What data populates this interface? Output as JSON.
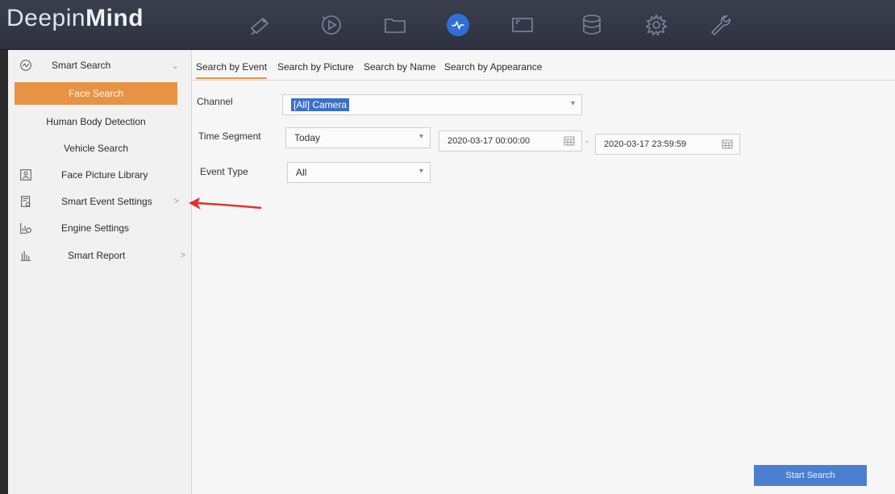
{
  "app": {
    "logo_light": "Deepin",
    "logo_bold": "Mind"
  },
  "topbar": {
    "icons": [
      "camera-icon",
      "playback-icon",
      "folder-icon",
      "smart-analysis-icon",
      "video-wall-icon",
      "storage-icon",
      "settings-gear-icon",
      "maintenance-wrench-icon"
    ],
    "active_icon": "smart-analysis-icon"
  },
  "sidebar": {
    "items": [
      {
        "label": "Smart Search",
        "icon": "smart-search-icon",
        "chevron": "⌄"
      },
      {
        "label": "Face Search",
        "active": true
      },
      {
        "label": "Human Body Detection"
      },
      {
        "label": "Vehicle Search"
      },
      {
        "label": "Face Picture Library",
        "icon": "face-library-icon"
      },
      {
        "label": "Smart Event Settings",
        "icon": "event-settings-icon",
        "chevron": ">"
      },
      {
        "label": "Engine Settings",
        "icon": "engine-settings-icon"
      },
      {
        "label": "Smart Report",
        "icon": "report-chart-icon",
        "chevron": ">"
      }
    ]
  },
  "tabs": [
    {
      "label": "Search by Event",
      "active": true
    },
    {
      "label": "Search by Picture"
    },
    {
      "label": "Search by Name"
    },
    {
      "label": "Search by Appearance"
    }
  ],
  "form": {
    "channel_label": "Channel",
    "channel_value": "[All] Camera",
    "time_segment_label": "Time Segment",
    "time_segment_value": "Today",
    "start_datetime": "2020-03-17 00:00:00",
    "date_separator": "-",
    "end_datetime": "2020-03-17 23:59:59",
    "event_type_label": "Event Type",
    "event_type_value": "All"
  },
  "actions": {
    "start_search": "Start Search"
  },
  "colors": {
    "accent_orange": "#e69345",
    "primary_blue": "#4a7fd0",
    "annotation_red": "#e0322b"
  }
}
